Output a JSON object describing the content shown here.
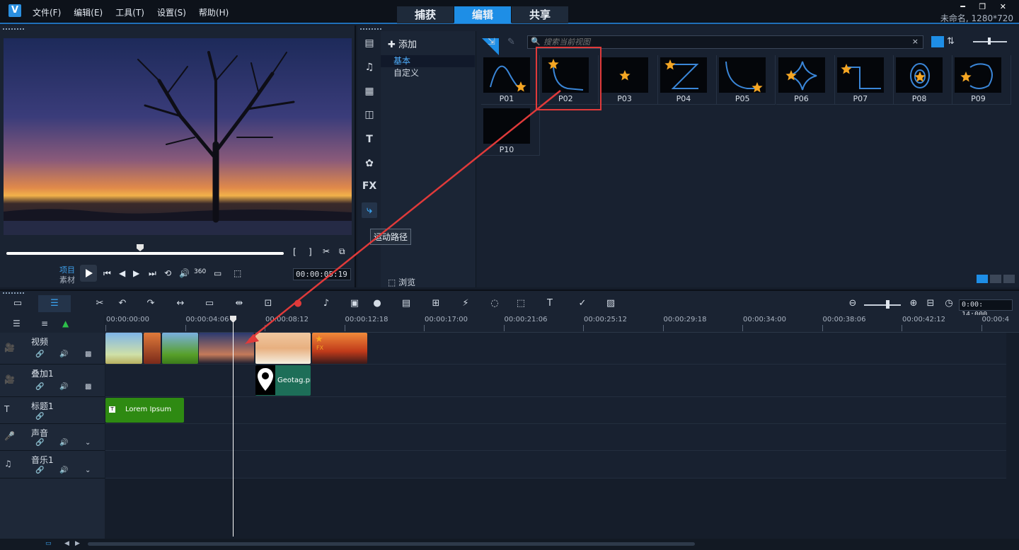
{
  "app": {
    "menu": [
      "文件(F)",
      "编辑(E)",
      "工具(T)",
      "设置(S)",
      "帮助(H)"
    ],
    "modes": [
      "捕获",
      "编辑",
      "共享"
    ],
    "active_mode": 1,
    "project_info": "未命名, 1280*720",
    "window_controls": "━ ❐ ✕"
  },
  "preview": {
    "project_label": "项目",
    "clip_label": "素材",
    "timecode": "00:00:05:19",
    "icons": [
      "mark-in-icon",
      "mark-out-icon",
      "scissors-icon",
      "copy-icon",
      "play-icon",
      "go-start-icon",
      "prev-frame-icon",
      "next-frame-icon",
      "go-end-icon",
      "repeat-icon",
      "volume-icon",
      "360-icon",
      "aspect-icon",
      "snapshot-icon"
    ]
  },
  "library": {
    "add_label": "添加",
    "folders": [
      "基本",
      "自定义"
    ],
    "selected_folder": 0,
    "browse_label": "浏览",
    "search_placeholder": "搜索当前视图",
    "tooltip": "运动路径",
    "side_icons": [
      "media-icon",
      "audio-icon",
      "instant-project-icon",
      "transition-icon",
      "title-icon",
      "graphics-icon",
      "fx-icon",
      "motion-path-icon"
    ],
    "fx_label": "FX",
    "title_glyph": "T",
    "paths": [
      {
        "label": "P01"
      },
      {
        "label": "P02"
      },
      {
        "label": "P03"
      },
      {
        "label": "P04"
      },
      {
        "label": "P05"
      },
      {
        "label": "P06"
      },
      {
        "label": "P07"
      },
      {
        "label": "P08"
      },
      {
        "label": "P09"
      },
      {
        "label": "P10"
      }
    ],
    "highlighted_path": 1
  },
  "timeline": {
    "time": "0:00: 14:000",
    "ruler": [
      "00:00:00:00",
      "00:00:04:06",
      "00:00:08:12",
      "00:00:12:18",
      "00:00:17:00",
      "00:00:21:06",
      "00:00:25:12",
      "00:00:29:18",
      "00:00:34:00",
      "00:00:38:06",
      "00:00:42:12",
      "00:00:4"
    ],
    "tracks": [
      {
        "name": "视频"
      },
      {
        "name": "叠加1"
      },
      {
        "name": "标题1"
      },
      {
        "name": "声音"
      },
      {
        "name": "音乐1"
      }
    ],
    "overlay_clip": "Geotag.pn",
    "title_clip": "Lorem Ipsum",
    "fx_badge": "FX"
  },
  "colors": {
    "accent": "#1e8ee6",
    "highlight": "#e03a3a",
    "path_line": "#3a86d8",
    "star": "#f5a623",
    "title_clip": "#2e8a12",
    "overlay_clip": "#1d6e58"
  }
}
